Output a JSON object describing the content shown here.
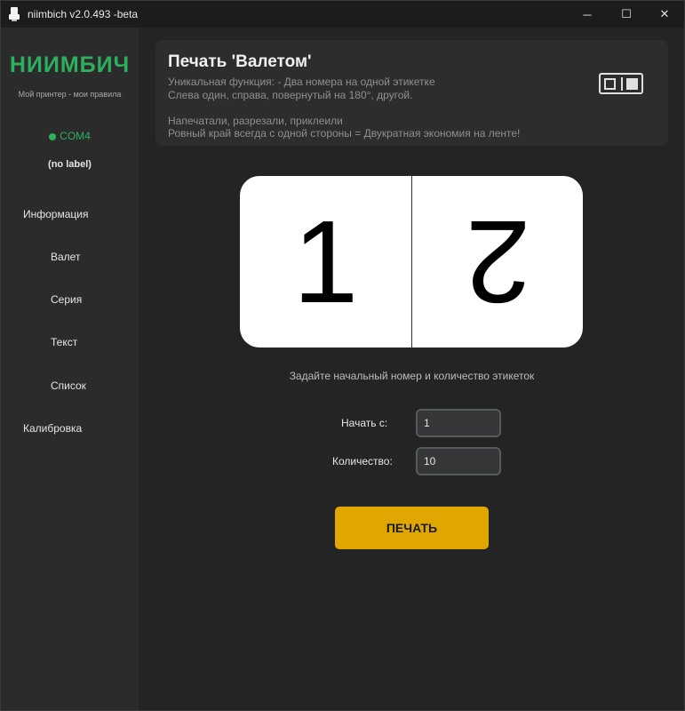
{
  "window": {
    "title": "niimbich v2.0.493 -beta",
    "minimize_glyph": "─",
    "maximize_glyph": "☐",
    "close_glyph": "✕"
  },
  "sidebar": {
    "brand": "НИИМБИЧ",
    "tagline": "Мой принтер - мои правила",
    "port": "COM4",
    "label": "(no label)",
    "items": [
      {
        "label": "Информация"
      },
      {
        "label": "Валет"
      },
      {
        "label": "Серия"
      },
      {
        "label": "Текст"
      },
      {
        "label": "Список"
      },
      {
        "label": "Калибровка"
      }
    ]
  },
  "banner": {
    "title": "Печать 'Валетом'",
    "line1": "Уникальная функция: - Два номера на одной этикетке",
    "line2": "Слева один, справа, повернутый на 180°, другой.",
    "line3": "Напечатали, разрезали, приклеили",
    "line4": "Ровный край всегда с одной стороны = Двукратная экономия на ленте!"
  },
  "preview": {
    "left_number": "1",
    "right_number": "2"
  },
  "form": {
    "hint": "Задайте начальный номер и количество этикеток",
    "start_label": "Начать с:",
    "start_value": "1",
    "count_label": "Количество:",
    "count_value": "10",
    "print_label": "ПЕЧАТЬ"
  },
  "colors": {
    "accent": "#2bb05e",
    "print_button": "#e0a700"
  }
}
